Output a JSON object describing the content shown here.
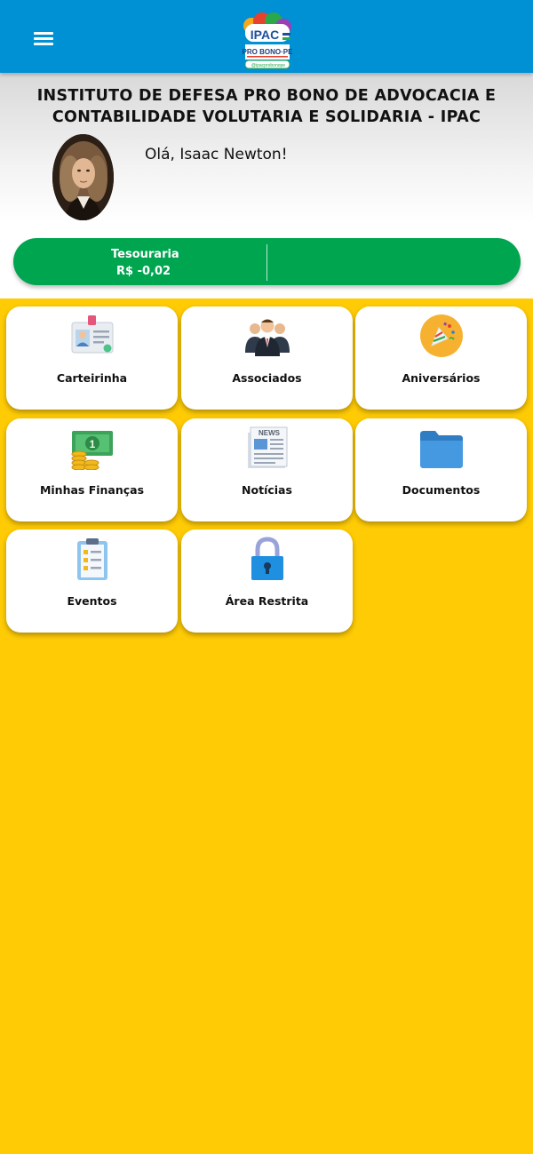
{
  "header": {
    "menu_icon": "hamburger-menu-icon",
    "logo": {
      "line1": "IPAC",
      "line2": "PRO BONO·PE",
      "line3": "@ipacprobonope"
    }
  },
  "profile": {
    "organization": "INSTITUTO DE DEFESA PRO BONO DE ADVOCACIA E CONTABILIDADE VOLUTARIA E SOLIDARIA - IPAC",
    "greeting": "Olá, Isaac Newton!"
  },
  "treasury": {
    "title": "Tesouraria",
    "value": "R$ -0,02",
    "color": "#00A550"
  },
  "tiles": [
    {
      "label": "Carteirinha",
      "icon": "id-card-icon"
    },
    {
      "label": "Associados",
      "icon": "people-group-icon"
    },
    {
      "label": "Aniversários",
      "icon": "party-popper-icon"
    },
    {
      "label": "Minhas Finanças",
      "icon": "money-coins-icon"
    },
    {
      "label": "Notícias",
      "icon": "newspaper-icon"
    },
    {
      "label": "Documentos",
      "icon": "folder-icon"
    },
    {
      "label": "Eventos",
      "icon": "clipboard-checklist-icon"
    },
    {
      "label": "Área Restrita",
      "icon": "padlock-icon"
    }
  ],
  "colors": {
    "header": "#0091D5",
    "background": "#FFCB05",
    "accent_green": "#00A550"
  }
}
